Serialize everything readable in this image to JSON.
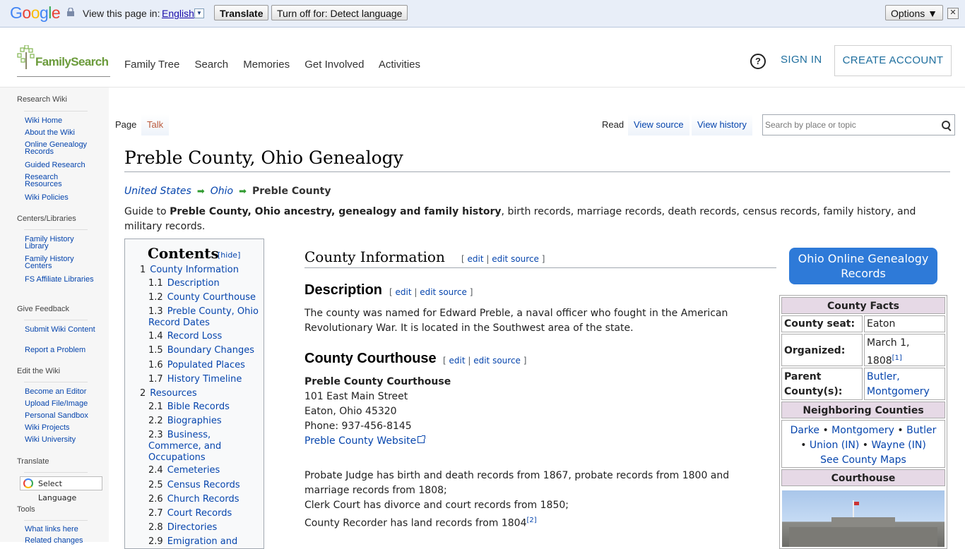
{
  "translate_bar": {
    "logo": "Google",
    "view_text": "View this page in:",
    "language": "English",
    "translate_button": "Translate",
    "turn_off_button": "Turn off for: Detect language",
    "options_button": "Options ▼"
  },
  "header": {
    "logo_text": "FamilySearch",
    "nav": [
      "Family Tree",
      "Search",
      "Memories",
      "Get Involved",
      "Activities"
    ],
    "sign_in": "SIGN IN",
    "create_account": "CREATE ACCOUNT"
  },
  "sidebar": {
    "research_wiki": "Research Wiki",
    "research_links": [
      "Wiki Home",
      "About the Wiki",
      "Online Genealogy Records",
      "Guided Research",
      "Research Resources",
      "Wiki Policies"
    ],
    "centers_heading": "Centers/Libraries",
    "centers_links": [
      "Family History Library",
      "Family History Centers",
      "FS Affiliate Libraries"
    ],
    "feedback_heading": "Give Feedback",
    "feedback_links": [
      "Submit Wiki Content",
      "Report a Problem"
    ],
    "edit_heading": "Edit the Wiki",
    "edit_links": [
      "Become an Editor",
      "Upload File/Image",
      "Personal Sandbox",
      "Wiki Projects",
      "Wiki University"
    ],
    "translate_heading": "Translate",
    "select_language": "Select Language",
    "tools_heading": "Tools",
    "tools_links": [
      "What links here",
      "Related changes"
    ]
  },
  "tabs": {
    "page": "Page",
    "talk": "Talk",
    "read": "Read",
    "view_source": "View source",
    "view_history": "View history",
    "search_placeholder": "Search by place or topic"
  },
  "article": {
    "title": "Preble County, Ohio Genealogy",
    "breadcrumb": [
      "United States",
      "Ohio",
      "Preble County"
    ],
    "intro_prefix": "Guide to ",
    "intro_bold": "Preble County, Ohio ancestry, genealogy and family history",
    "intro_rest": ", birth records, marriage records, death records, census records, family history, and military records."
  },
  "toc": {
    "title": "Contents",
    "hide": "[hide]",
    "items": [
      {
        "num": "1",
        "label": "County Information"
      },
      {
        "num": "1.1",
        "label": "Description"
      },
      {
        "num": "1.2",
        "label": "County Courthouse"
      },
      {
        "num": "1.3",
        "label": "Preble County, Ohio Record Dates"
      },
      {
        "num": "1.4",
        "label": "Record Loss"
      },
      {
        "num": "1.5",
        "label": "Boundary Changes"
      },
      {
        "num": "1.6",
        "label": "Populated Places"
      },
      {
        "num": "1.7",
        "label": "History Timeline"
      },
      {
        "num": "2",
        "label": "Resources"
      },
      {
        "num": "2.1",
        "label": "Bible Records"
      },
      {
        "num": "2.2",
        "label": "Biographies"
      },
      {
        "num": "2.3",
        "label": "Business, Commerce, and Occupations"
      },
      {
        "num": "2.4",
        "label": "Cemeteries"
      },
      {
        "num": "2.5",
        "label": "Census Records"
      },
      {
        "num": "2.6",
        "label": "Church Records"
      },
      {
        "num": "2.7",
        "label": "Court Records"
      },
      {
        "num": "2.8",
        "label": "Directories"
      },
      {
        "num": "2.9",
        "label": "Emigration and"
      }
    ]
  },
  "sections": {
    "county_info": "County Information",
    "edit": "edit",
    "edit_source": "edit source",
    "description": "Description",
    "description_text": "The county was named for Edward Preble, a naval officer who fought in the American Revolutionary War. It is located in the Southwest area of the state.",
    "courthouse": "County Courthouse",
    "courthouse_name": "Preble County Courthouse",
    "address1": "101 East Main Street",
    "address2": "Eaton, Ohio 45320",
    "phone": "Phone: 937-456-8145",
    "website": "Preble County Website",
    "probate": "Probate Judge has birth and death records from 1867, probate records from 1800 and marriage records from 1808;",
    "clerk": "Clerk Court has divorce and court records from 1850;",
    "recorder": "County Recorder has land records from 1804",
    "recorder_ref": "[2]"
  },
  "infobox": {
    "online_button": "Ohio Online Genealogy Records",
    "facts_title": "County Facts",
    "seat_label": "County seat:",
    "seat_value": "Eaton",
    "organized_label": "Organized:",
    "organized_value": "March 1, 1808",
    "organized_ref": "[1]",
    "parent_label": "Parent County(s):",
    "parent_value1": "Butler,",
    "parent_value2": "Montgomery",
    "neighboring_title": "Neighboring Counties",
    "neighbors": [
      "Darke",
      "Montgomery",
      "Butler",
      "Union (IN)",
      "Wayne (IN)"
    ],
    "see_maps": "See County Maps",
    "courthouse_title": "Courthouse"
  }
}
